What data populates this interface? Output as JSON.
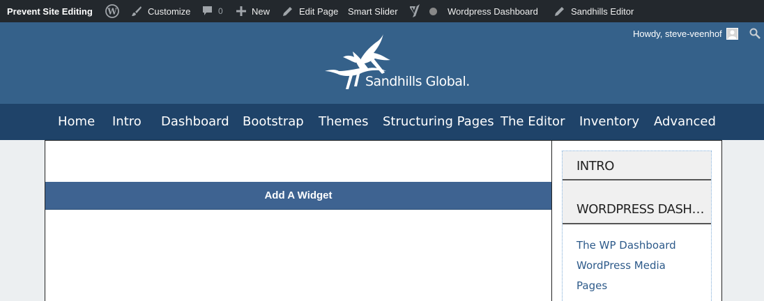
{
  "adminbar": {
    "site_name": "Prevent Site Editing",
    "wp_logo_icon": "wordpress-logo-icon",
    "customize": "Customize",
    "comments_count": "0",
    "new": "New",
    "edit_page": "Edit Page",
    "smart_slider": "Smart Slider",
    "yoast_icon": "yoast-icon",
    "wordpress_dashboard": "Wordpress Dashboard",
    "sandhills_editor": "Sandhills Editor",
    "howdy": "Howdy, steve-veenhof"
  },
  "header": {
    "logo_text": "Sandhills Global."
  },
  "nav": {
    "items": [
      "Home",
      "Intro",
      "Dashboard",
      "Bootstrap",
      "Themes",
      "Structuring Pages",
      "The Editor",
      "Inventory",
      "Advanced"
    ]
  },
  "main": {
    "widget_label": "Add A Widget"
  },
  "sidebar": {
    "headings": [
      "INTRO",
      "WORDPRESS DASHBOA..."
    ],
    "links": [
      "The WP Dashboard",
      "WordPress Media",
      "Pages"
    ]
  },
  "colors": {
    "adminbar_bg": "#23282d",
    "header_bg": "#35618a",
    "nav_bg": "#1f4369",
    "widget_bar_bg": "#3e6391",
    "link": "#2d5a8a"
  }
}
